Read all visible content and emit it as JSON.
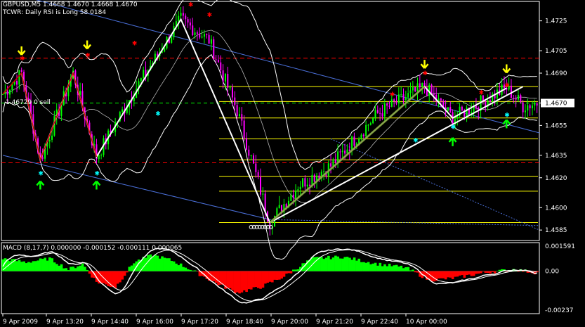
{
  "header": {
    "symbol_line": "GBPUSD,M5  1.4668 1.4670 1.4668 1.4670",
    "indicator_line": "TCWR: Daily RSI is Long 58.0184",
    "trade_label": "1.46729  0 sell"
  },
  "macd": {
    "label": "MACD  (8,17,7) 0.000000 -0.000152 -0.000111 0.000065",
    "axis": [
      "0.001591",
      "0.00",
      "-0.00237"
    ]
  },
  "price_axis": {
    "ticks": [
      "1.4725",
      "1.4705",
      "1.4690",
      "1.4670",
      "1.4655",
      "1.4635",
      "1.4620",
      "1.4600",
      "1.4585"
    ],
    "current_price": "1.4670"
  },
  "time_axis": [
    "9 Apr 2009",
    "9 Apr 13:20",
    "9 Apr 14:40",
    "9 Apr 16:00",
    "9 Apr 17:20",
    "9 Apr 18:40",
    "9 Apr 20:00",
    "9 Apr 21:20",
    "9 Apr 22:40",
    "10 Apr 00:00"
  ],
  "colors": {
    "background": "#000000",
    "bull_candle": "#00ff00",
    "bear_candle": "#ff00ff",
    "macd_positive": "#00ff00",
    "macd_negative": "#ff0000",
    "channel": "#4a6fd8",
    "fib": "#ffff00",
    "bands": "#ffffff",
    "resistance": "#ff0000",
    "arrow_down": "#ffff00",
    "arrow_up": "#00ff00",
    "star_marker": "#00ffff"
  },
  "chart_data": [
    {
      "type": "line",
      "title": "GBPUSD,M5",
      "ylim": [
        1.4578,
        1.4738
      ],
      "price_anchors": [
        {
          "bar": 0,
          "price": 1.4676
        },
        {
          "bar": 8,
          "price": 1.469
        },
        {
          "bar": 16,
          "price": 1.4632
        },
        {
          "bar": 30,
          "price": 1.469
        },
        {
          "bar": 40,
          "price": 1.4634
        },
        {
          "bar": 56,
          "price": 1.4678
        },
        {
          "bar": 76,
          "price": 1.4726
        },
        {
          "bar": 88,
          "price": 1.4712
        },
        {
          "bar": 100,
          "price": 1.4665
        },
        {
          "bar": 114,
          "price": 1.459
        },
        {
          "bar": 126,
          "price": 1.4615
        },
        {
          "bar": 140,
          "price": 1.4628
        },
        {
          "bar": 160,
          "price": 1.4663
        },
        {
          "bar": 180,
          "price": 1.4681
        },
        {
          "bar": 192,
          "price": 1.466
        },
        {
          "bar": 215,
          "price": 1.468
        },
        {
          "bar": 222,
          "price": 1.4668
        },
        {
          "bar": 228,
          "price": 1.467
        }
      ],
      "zigzag": [
        {
          "bar": 8,
          "price": 1.469
        },
        {
          "bar": 16,
          "price": 1.4632
        },
        {
          "bar": 30,
          "price": 1.469
        },
        {
          "bar": 40,
          "price": 1.4634
        },
        {
          "bar": 76,
          "price": 1.4726
        },
        {
          "bar": 114,
          "price": 1.459
        },
        {
          "bar": 180,
          "price": 1.4681
        },
        {
          "bar": 192,
          "price": 1.466
        },
        {
          "bar": 215,
          "price": 1.468
        }
      ],
      "fib_levels": [
        1.4681,
        1.4671,
        1.466,
        1.4646,
        1.4632,
        1.4621,
        1.4611,
        1.459
      ],
      "resistance_levels": [
        1.47,
        1.463
      ],
      "current_price": 1.467
    },
    {
      "type": "bar",
      "title": "MACD (8,17,7)",
      "ylim": [
        -0.00237,
        0.001591
      ],
      "histogram_anchors": [
        {
          "bar": 0,
          "value": 0.0007
        },
        {
          "bar": 10,
          "value": 0.0005
        },
        {
          "bar": 20,
          "value": 0.0007
        },
        {
          "bar": 28,
          "value": 0.0001
        },
        {
          "bar": 34,
          "value": 0.0004
        },
        {
          "bar": 40,
          "value": -0.0006
        },
        {
          "bar": 48,
          "value": -0.0009
        },
        {
          "bar": 56,
          "value": 0.0005
        },
        {
          "bar": 64,
          "value": 0.0009
        },
        {
          "bar": 72,
          "value": 0.0006
        },
        {
          "bar": 80,
          "value": 0.0001
        },
        {
          "bar": 90,
          "value": -0.0006
        },
        {
          "bar": 100,
          "value": -0.0012
        },
        {
          "bar": 110,
          "value": -0.0009
        },
        {
          "bar": 120,
          "value": -0.0003
        },
        {
          "bar": 132,
          "value": 0.0007
        },
        {
          "bar": 145,
          "value": 0.0008
        },
        {
          "bar": 160,
          "value": 0.0004
        },
        {
          "bar": 172,
          "value": 0.0002
        },
        {
          "bar": 182,
          "value": -0.0005
        },
        {
          "bar": 192,
          "value": -0.0004
        },
        {
          "bar": 205,
          "value": -0.0001
        },
        {
          "bar": 218,
          "value": 0.0001
        },
        {
          "bar": 228,
          "value": -0.0001
        }
      ]
    }
  ]
}
